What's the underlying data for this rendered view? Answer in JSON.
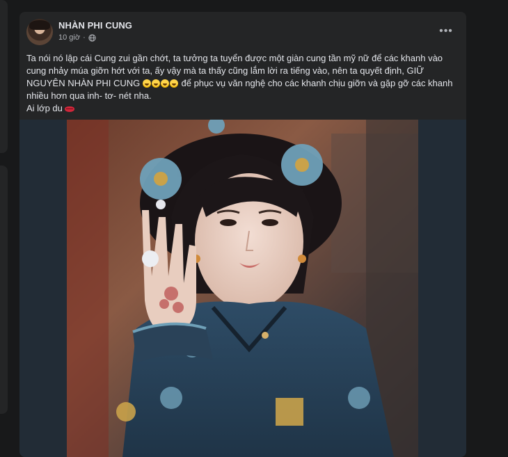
{
  "post": {
    "author": "NHÀN PHI CUNG",
    "time": "10 giờ",
    "separator": "·",
    "more_label": "•••",
    "text_main": "Ta nói nó lập cái Cung zui gần chớt, ta tưởng ta tuyển được một giàn cung tần mỹ nữ để các khanh vào cung nhảy múa giỡn hớt với ta, ấy vậy mà ta thấy cũng lắm lời ra tiếng vào, nên ta quyết định, GIỮ NGUYÊN NHÀN PHI CUNG",
    "text_after_emoji": "để phục vụ văn nghệ cho các khanh chịu giỡn và gặp gỡ các khanh nhiều hơn qua inh- tơ- nét nha.",
    "emoji_icons": [
      "rofl-emoji",
      "rofl-emoji",
      "rofl-emoji",
      "rofl-emoji"
    ],
    "text_line2": "Ai lớp du",
    "closing_icon": "lips-icon",
    "image_alt": "post-photo"
  },
  "colors": {
    "page_bg": "#18191a",
    "card_bg": "#242526",
    "primary_text": "#e4e6eb",
    "secondary_text": "#b0b3b8",
    "photo_frame": "#222c36"
  }
}
